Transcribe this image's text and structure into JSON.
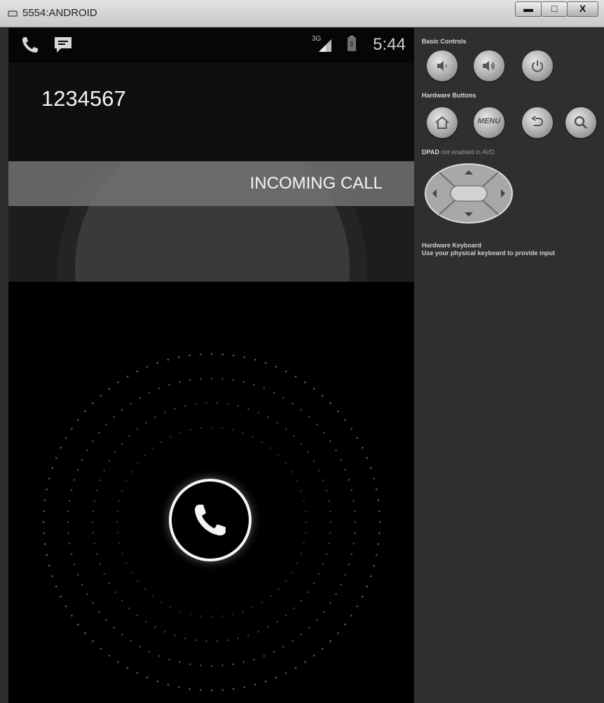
{
  "window": {
    "title": "5554:ANDROID",
    "minimize_glyph": "▬",
    "maximize_glyph": "□",
    "close_glyph": "X"
  },
  "status_bar": {
    "time": "5:44",
    "network": "3G",
    "notifications": [
      "phone-icon",
      "message-icon"
    ]
  },
  "call": {
    "number": "1234567",
    "label": "INCOMING CALL",
    "answer_icon": "phone-icon"
  },
  "controls": {
    "basic_controls_label": "Basic Controls",
    "basic_buttons": [
      "volume-down-icon",
      "volume-up-icon",
      "power-icon"
    ],
    "hardware_buttons_label": "Hardware Buttons",
    "hardware_buttons": [
      "home-icon",
      "menu",
      "back-icon",
      "search-icon"
    ],
    "menu_label": "MENU",
    "dpad_label": "DPAD",
    "dpad_note": "not enabled in AVD",
    "keyboard_title": "Hardware Keyboard",
    "keyboard_note": "Use your physical keyboard to provide input"
  }
}
